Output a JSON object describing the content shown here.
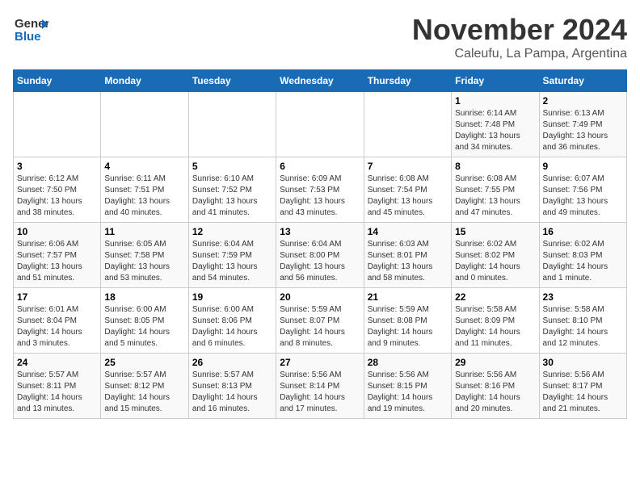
{
  "logo": {
    "line1": "General",
    "line2": "Blue"
  },
  "title": "November 2024",
  "location": "Caleufu, La Pampa, Argentina",
  "days_header": [
    "Sunday",
    "Monday",
    "Tuesday",
    "Wednesday",
    "Thursday",
    "Friday",
    "Saturday"
  ],
  "weeks": [
    [
      {
        "day": "",
        "info": ""
      },
      {
        "day": "",
        "info": ""
      },
      {
        "day": "",
        "info": ""
      },
      {
        "day": "",
        "info": ""
      },
      {
        "day": "",
        "info": ""
      },
      {
        "day": "1",
        "info": "Sunrise: 6:14 AM\nSunset: 7:48 PM\nDaylight: 13 hours\nand 34 minutes."
      },
      {
        "day": "2",
        "info": "Sunrise: 6:13 AM\nSunset: 7:49 PM\nDaylight: 13 hours\nand 36 minutes."
      }
    ],
    [
      {
        "day": "3",
        "info": "Sunrise: 6:12 AM\nSunset: 7:50 PM\nDaylight: 13 hours\nand 38 minutes."
      },
      {
        "day": "4",
        "info": "Sunrise: 6:11 AM\nSunset: 7:51 PM\nDaylight: 13 hours\nand 40 minutes."
      },
      {
        "day": "5",
        "info": "Sunrise: 6:10 AM\nSunset: 7:52 PM\nDaylight: 13 hours\nand 41 minutes."
      },
      {
        "day": "6",
        "info": "Sunrise: 6:09 AM\nSunset: 7:53 PM\nDaylight: 13 hours\nand 43 minutes."
      },
      {
        "day": "7",
        "info": "Sunrise: 6:08 AM\nSunset: 7:54 PM\nDaylight: 13 hours\nand 45 minutes."
      },
      {
        "day": "8",
        "info": "Sunrise: 6:08 AM\nSunset: 7:55 PM\nDaylight: 13 hours\nand 47 minutes."
      },
      {
        "day": "9",
        "info": "Sunrise: 6:07 AM\nSunset: 7:56 PM\nDaylight: 13 hours\nand 49 minutes."
      }
    ],
    [
      {
        "day": "10",
        "info": "Sunrise: 6:06 AM\nSunset: 7:57 PM\nDaylight: 13 hours\nand 51 minutes."
      },
      {
        "day": "11",
        "info": "Sunrise: 6:05 AM\nSunset: 7:58 PM\nDaylight: 13 hours\nand 53 minutes."
      },
      {
        "day": "12",
        "info": "Sunrise: 6:04 AM\nSunset: 7:59 PM\nDaylight: 13 hours\nand 54 minutes."
      },
      {
        "day": "13",
        "info": "Sunrise: 6:04 AM\nSunset: 8:00 PM\nDaylight: 13 hours\nand 56 minutes."
      },
      {
        "day": "14",
        "info": "Sunrise: 6:03 AM\nSunset: 8:01 PM\nDaylight: 13 hours\nand 58 minutes."
      },
      {
        "day": "15",
        "info": "Sunrise: 6:02 AM\nSunset: 8:02 PM\nDaylight: 14 hours\nand 0 minutes."
      },
      {
        "day": "16",
        "info": "Sunrise: 6:02 AM\nSunset: 8:03 PM\nDaylight: 14 hours\nand 1 minute."
      }
    ],
    [
      {
        "day": "17",
        "info": "Sunrise: 6:01 AM\nSunset: 8:04 PM\nDaylight: 14 hours\nand 3 minutes."
      },
      {
        "day": "18",
        "info": "Sunrise: 6:00 AM\nSunset: 8:05 PM\nDaylight: 14 hours\nand 5 minutes."
      },
      {
        "day": "19",
        "info": "Sunrise: 6:00 AM\nSunset: 8:06 PM\nDaylight: 14 hours\nand 6 minutes."
      },
      {
        "day": "20",
        "info": "Sunrise: 5:59 AM\nSunset: 8:07 PM\nDaylight: 14 hours\nand 8 minutes."
      },
      {
        "day": "21",
        "info": "Sunrise: 5:59 AM\nSunset: 8:08 PM\nDaylight: 14 hours\nand 9 minutes."
      },
      {
        "day": "22",
        "info": "Sunrise: 5:58 AM\nSunset: 8:09 PM\nDaylight: 14 hours\nand 11 minutes."
      },
      {
        "day": "23",
        "info": "Sunrise: 5:58 AM\nSunset: 8:10 PM\nDaylight: 14 hours\nand 12 minutes."
      }
    ],
    [
      {
        "day": "24",
        "info": "Sunrise: 5:57 AM\nSunset: 8:11 PM\nDaylight: 14 hours\nand 13 minutes."
      },
      {
        "day": "25",
        "info": "Sunrise: 5:57 AM\nSunset: 8:12 PM\nDaylight: 14 hours\nand 15 minutes."
      },
      {
        "day": "26",
        "info": "Sunrise: 5:57 AM\nSunset: 8:13 PM\nDaylight: 14 hours\nand 16 minutes."
      },
      {
        "day": "27",
        "info": "Sunrise: 5:56 AM\nSunset: 8:14 PM\nDaylight: 14 hours\nand 17 minutes."
      },
      {
        "day": "28",
        "info": "Sunrise: 5:56 AM\nSunset: 8:15 PM\nDaylight: 14 hours\nand 19 minutes."
      },
      {
        "day": "29",
        "info": "Sunrise: 5:56 AM\nSunset: 8:16 PM\nDaylight: 14 hours\nand 20 minutes."
      },
      {
        "day": "30",
        "info": "Sunrise: 5:56 AM\nSunset: 8:17 PM\nDaylight: 14 hours\nand 21 minutes."
      }
    ]
  ]
}
